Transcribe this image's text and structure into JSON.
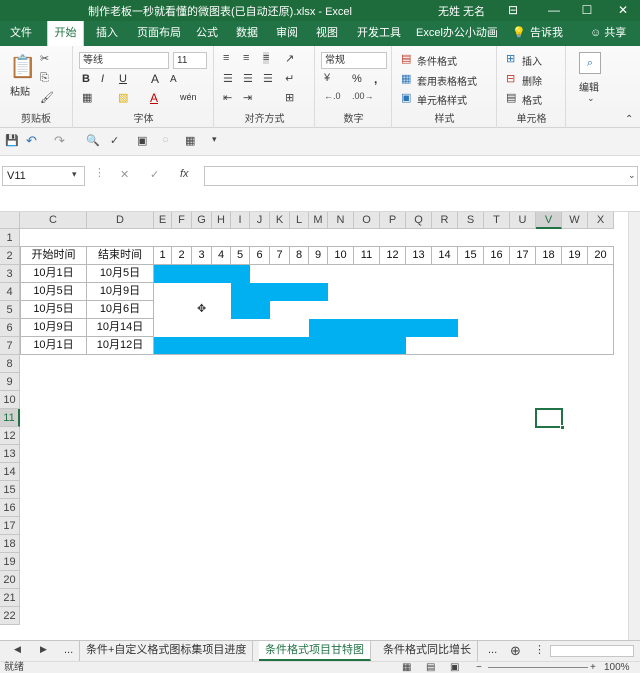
{
  "window": {
    "title": "制作老板一秒就看懂的微图表(已自动还原).xlsx  -  Excel",
    "user": "无姓 无名",
    "controls": [
      "⊟",
      "—",
      "☐",
      "✕"
    ]
  },
  "ribbon_tabs": [
    "文件",
    "开始",
    "插入",
    "页面布局",
    "公式",
    "数据",
    "审阅",
    "视图",
    "开发工具",
    "Excel办公小动画",
    "告诉我",
    "共享"
  ],
  "active_ribbon_tab": "开始",
  "ribbon": {
    "clipboard": {
      "paste": "粘贴",
      "label": "剪贴板"
    },
    "font": {
      "name": "等线",
      "size": "11",
      "bold": "B",
      "italic": "I",
      "underline": "U",
      "grow": "A",
      "shrink": "A",
      "font_color": "A",
      "phonetic": "wén",
      "label": "字体"
    },
    "alignment": {
      "label": "对齐方式"
    },
    "number": {
      "format": "常规",
      "percent": "%",
      "comma": ",",
      "label": "数字"
    },
    "styles": {
      "conditional": "条件格式",
      "table": "套用表格格式",
      "cell_styles": "单元格样式",
      "label": "样式"
    },
    "cells": {
      "insert": "插入",
      "delete": "删除",
      "format": "格式",
      "label": "单元格"
    },
    "editing": {
      "label": "编辑"
    }
  },
  "formula_bar": {
    "name_box": "V11",
    "cancel": "✕",
    "enter": "✓",
    "fx": "fx",
    "content": ""
  },
  "columns": [
    "C",
    "D",
    "E",
    "F",
    "G",
    "H",
    "I",
    "J",
    "K",
    "L",
    "M",
    "N",
    "O",
    "P",
    "Q",
    "R",
    "S",
    "T",
    "U",
    "V",
    "W",
    "X"
  ],
  "selected_column": "V",
  "rows": [
    "1",
    "2",
    "3",
    "4",
    "5",
    "6",
    "7",
    "8",
    "9",
    "10",
    "11",
    "12",
    "13",
    "14",
    "15",
    "16",
    "17",
    "18",
    "19",
    "20",
    "21",
    "22"
  ],
  "selected_row": "11",
  "table": {
    "headers": [
      "开始时间",
      "结束时间"
    ],
    "day_numbers": [
      "1",
      "2",
      "3",
      "4",
      "5",
      "6",
      "7",
      "8",
      "9",
      "10",
      "11",
      "12",
      "13",
      "14",
      "15",
      "16",
      "17",
      "18",
      "19",
      "20"
    ],
    "rows": [
      {
        "start": "10月1日",
        "end": "10月5日"
      },
      {
        "start": "10月5日",
        "end": "10月9日"
      },
      {
        "start": "10月5日",
        "end": "10月6日"
      },
      {
        "start": "10月9日",
        "end": "10月14日"
      },
      {
        "start": "10月1日",
        "end": "10月12日"
      }
    ]
  },
  "gantt_color": "#00b0f0",
  "sheet_tabs": [
    "...",
    "条件+自定义格式图标集项目进度",
    "条件格式项目甘特图",
    "条件格式同比增长",
    "..."
  ],
  "active_sheet": "条件格式项目甘特图",
  "status": {
    "ready": "就绪",
    "zoom": "100%"
  }
}
